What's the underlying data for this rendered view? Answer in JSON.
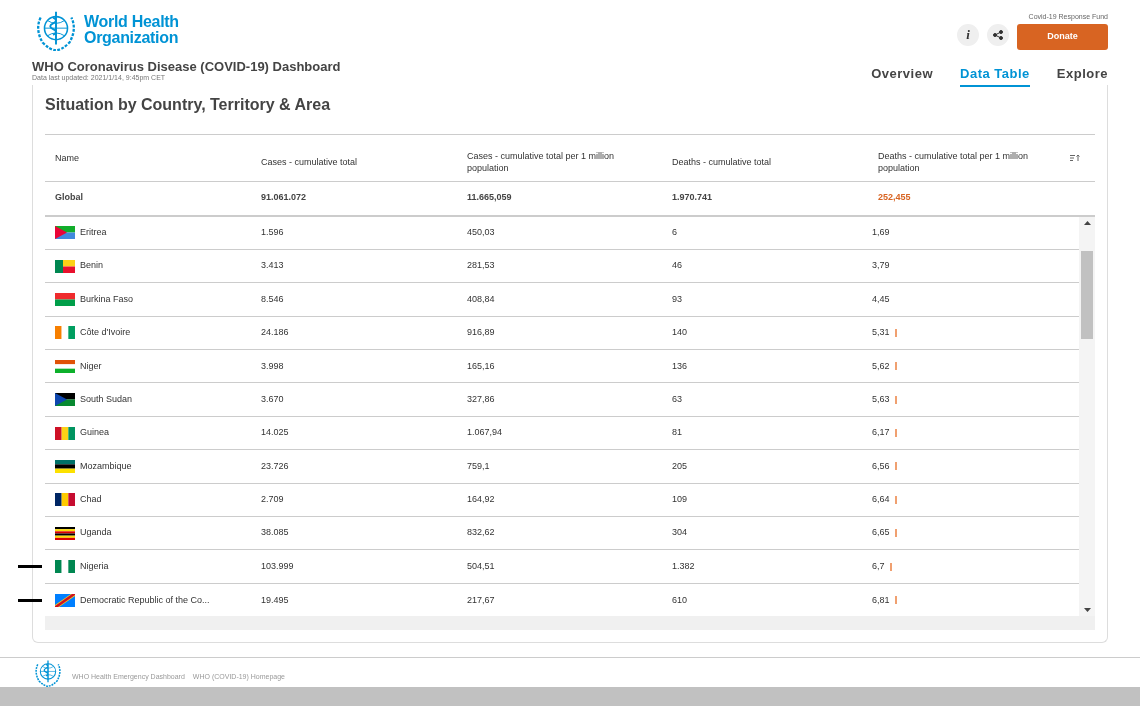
{
  "header": {
    "org_name": "World Health Organization",
    "title": "WHO Coronavirus Disease (COVID-19) Dashboard",
    "updated": "Data last updated: 2021/1/14, 9:45pm CET",
    "info_button": "i",
    "fund_label": "Covid-19 Response Fund",
    "donate": "Donate",
    "nav": [
      {
        "label": "Overview",
        "selected": false
      },
      {
        "label": "Data Table",
        "selected": true
      },
      {
        "label": "Explore",
        "selected": false
      }
    ]
  },
  "section_title": "Situation by Country, Territory & Area",
  "table": {
    "columns": [
      "Name",
      "Cases - cumulative total",
      "Cases - cumulative total per 1 million population",
      "Deaths - cumulative total",
      "Deaths - cumulative total per 1 million population"
    ],
    "global": [
      "Global",
      "91.061.072",
      "11.665,059",
      "1.970.741",
      "252,455"
    ],
    "rows": [
      {
        "cells": [
          "Eritrea",
          "1.596",
          "450,03",
          "6",
          "1,69"
        ],
        "kind": "eritrea",
        "bar": false,
        "marked": false
      },
      {
        "cells": [
          "Benin",
          "3.413",
          "281,53",
          "46",
          "3,79"
        ],
        "kind": "benin",
        "bar": false,
        "marked": false
      },
      {
        "cells": [
          "Burkina Faso",
          "8.546",
          "408,84",
          "93",
          "4,45"
        ],
        "kind": "burkina",
        "bar": false,
        "marked": false
      },
      {
        "cells": [
          "Côte d'Ivoire",
          "24.186",
          "916,89",
          "140",
          "5,31"
        ],
        "kind": "ivory",
        "bar": true,
        "marked": false
      },
      {
        "cells": [
          "Niger",
          "3.998",
          "165,16",
          "136",
          "5,62"
        ],
        "kind": "niger",
        "bar": true,
        "marked": false
      },
      {
        "cells": [
          "South Sudan",
          "3.670",
          "327,86",
          "63",
          "5,63"
        ],
        "kind": "ssudan",
        "bar": true,
        "marked": false
      },
      {
        "cells": [
          "Guinea",
          "14.025",
          "1.067,94",
          "81",
          "6,17"
        ],
        "kind": "guinea",
        "bar": true,
        "marked": false
      },
      {
        "cells": [
          "Mozambique",
          "23.726",
          "759,1",
          "205",
          "6,56"
        ],
        "kind": "mozambique",
        "bar": true,
        "marked": false
      },
      {
        "cells": [
          "Chad",
          "2.709",
          "164,92",
          "109",
          "6,64"
        ],
        "kind": "chad",
        "bar": true,
        "marked": false
      },
      {
        "cells": [
          "Uganda",
          "38.085",
          "832,62",
          "304",
          "6,65"
        ],
        "kind": "uganda",
        "bar": true,
        "marked": false
      },
      {
        "cells": [
          "Nigeria",
          "103.999",
          "504,51",
          "1.382",
          "6,7"
        ],
        "kind": "nigeria",
        "bar": true,
        "marked": true
      },
      {
        "cells": [
          "Democratic Republic of the Co...",
          "19.495",
          "217,67",
          "610",
          "6,81"
        ],
        "kind": "drc",
        "bar": true,
        "marked": true
      }
    ]
  },
  "footer": {
    "links": [
      "WHO Health Emergency Dashboard",
      "WHO (COVID-19) Homepage"
    ]
  }
}
